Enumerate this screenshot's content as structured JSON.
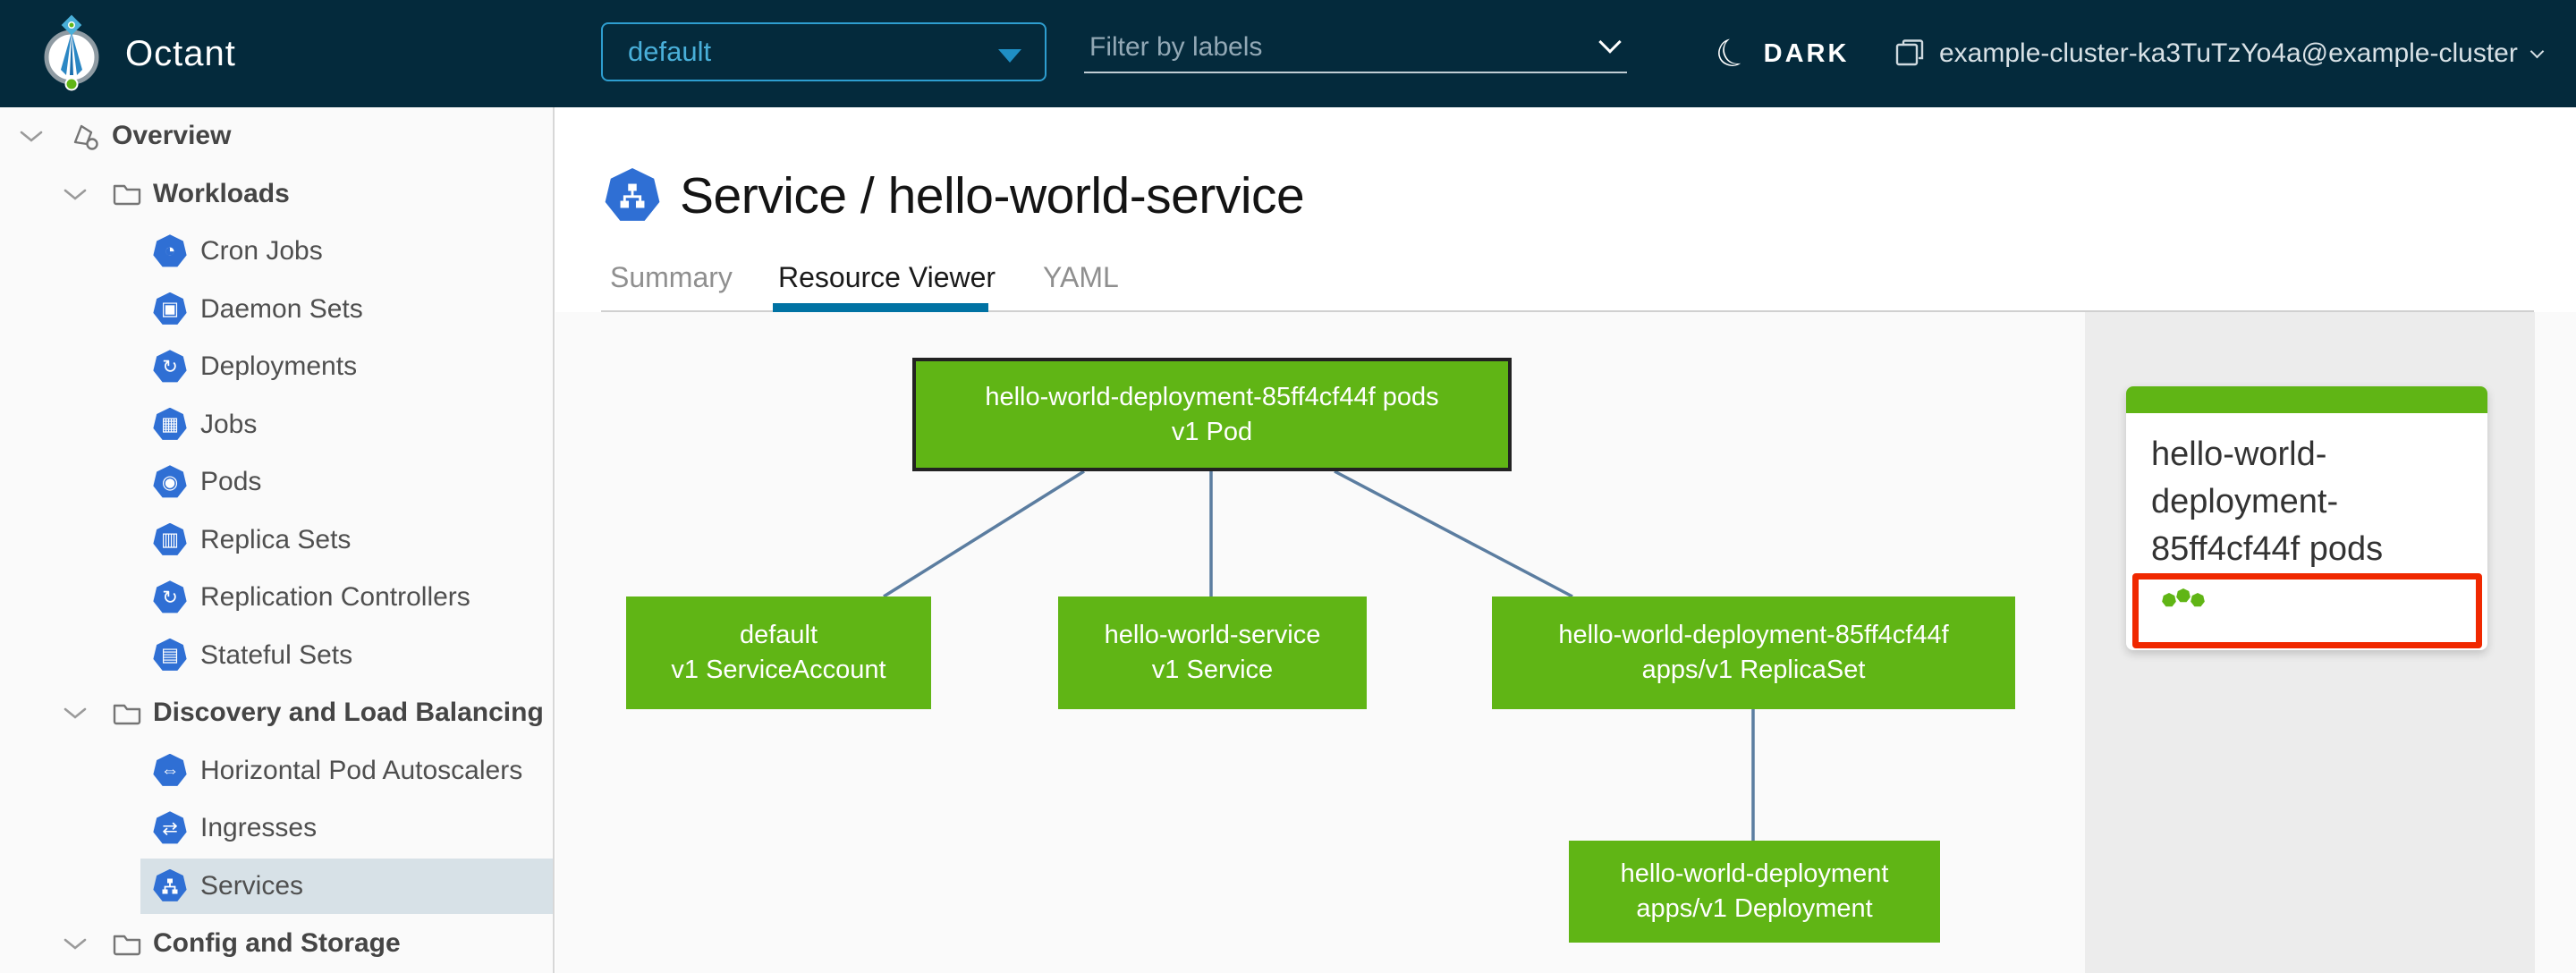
{
  "header": {
    "app_name": "Octant",
    "namespace_selector": {
      "value": "default"
    },
    "filter": {
      "placeholder": "Filter by labels"
    },
    "theme_toggle": {
      "label": "DARK"
    },
    "cluster": {
      "label": "example-cluster-ka3TuTzYo4a@example-cluster"
    }
  },
  "sidebar": {
    "items": [
      {
        "label": "Overview",
        "icon": "overview-icon",
        "level": 1,
        "group": true,
        "expanded": true
      },
      {
        "label": "Workloads",
        "icon": "folder-icon",
        "level": 2,
        "group": true,
        "expanded": true
      },
      {
        "label": "Cron Jobs",
        "icon": "cronjobs-icon",
        "level": 3
      },
      {
        "label": "Daemon Sets",
        "icon": "daemonsets-icon",
        "level": 3
      },
      {
        "label": "Deployments",
        "icon": "deployments-icon",
        "level": 3
      },
      {
        "label": "Jobs",
        "icon": "jobs-icon",
        "level": 3
      },
      {
        "label": "Pods",
        "icon": "pods-icon",
        "level": 3
      },
      {
        "label": "Replica Sets",
        "icon": "replicasets-icon",
        "level": 3
      },
      {
        "label": "Replication Controllers",
        "icon": "replicationcontrollers-icon",
        "level": 3
      },
      {
        "label": "Stateful Sets",
        "icon": "statefulsets-icon",
        "level": 3
      },
      {
        "label": "Discovery and Load Balancing",
        "icon": "folder-icon",
        "level": 2,
        "group": true,
        "expanded": true
      },
      {
        "label": "Horizontal Pod Autoscalers",
        "icon": "hpa-icon",
        "level": 3
      },
      {
        "label": "Ingresses",
        "icon": "ingresses-icon",
        "level": 3
      },
      {
        "label": "Services",
        "icon": "services-icon",
        "level": 3,
        "selected": true
      },
      {
        "label": "Config and Storage",
        "icon": "folder-icon",
        "level": 2,
        "group": true,
        "expanded": true
      }
    ]
  },
  "icons": {
    "cronjobs": "◔",
    "daemonsets": "▣",
    "deployments": "↻",
    "jobs": "▦",
    "pods": "◉",
    "replicasets": "▥",
    "replicationcontrollers": "↻",
    "statefulsets": "▤",
    "hpa": "⇔",
    "ingresses": "⇄",
    "moon": "☾"
  },
  "main": {
    "title": {
      "text": "Service / hello-world-service"
    },
    "tabs": [
      {
        "label": "Summary",
        "active": false
      },
      {
        "label": "Resource Viewer",
        "active": true
      },
      {
        "label": "YAML",
        "active": false
      }
    ]
  },
  "graph": {
    "nodes": [
      {
        "id": "pod",
        "line1": "hello-world-deployment-85ff4cf44f pods",
        "line2": "v1 Pod",
        "selected": true
      },
      {
        "id": "serviceaccount",
        "line1": "default",
        "line2": "v1 ServiceAccount",
        "selected": false
      },
      {
        "id": "service",
        "line1": "hello-world-service",
        "line2": "v1 Service",
        "selected": false
      },
      {
        "id": "replicaset",
        "line1": "hello-world-deployment-85ff4cf44f",
        "line2": "apps/v1 ReplicaSet",
        "selected": false
      },
      {
        "id": "deployment",
        "line1": "hello-world-deployment",
        "line2": "apps/v1 Deployment",
        "selected": false
      }
    ],
    "edges": [
      {
        "from": "pod",
        "to": "serviceaccount"
      },
      {
        "from": "pod",
        "to": "service"
      },
      {
        "from": "pod",
        "to": "replicaset"
      },
      {
        "from": "replicaset",
        "to": "deployment"
      }
    ]
  },
  "detail_panel": {
    "card": {
      "title": "hello-world-deployment-85ff4cf44f pods",
      "status_dots": 3,
      "highlighted": true
    }
  },
  "colors": {
    "header_bg": "#042a3c",
    "accent_blue": "#49afd9",
    "k8s_icon_blue": "#2f6fd4",
    "node_green": "#60b515",
    "selection_red": "#f02800",
    "edge_blue": "#5b7da0",
    "tab_active_underline": "#0072a3",
    "sidebar_selected_bg": "#d7e1e7"
  }
}
